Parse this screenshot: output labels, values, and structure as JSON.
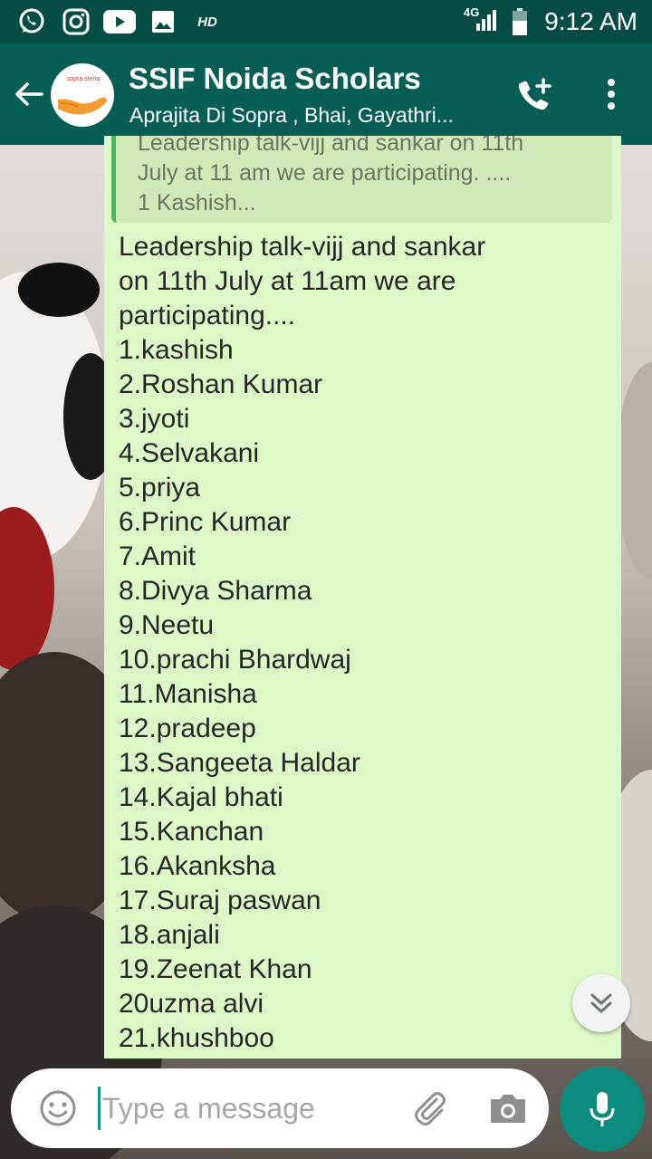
{
  "status_bar": {
    "time": "9:12 AM",
    "hd_label": "HD",
    "network_label": "4G",
    "icons": [
      "whatsapp-icon",
      "instagram-icon",
      "youtube-icon",
      "gallery-icon",
      "signal-icon",
      "battery-icon"
    ]
  },
  "toolbar": {
    "title": "SSIF Noida Scholars",
    "subtitle": "Aprajita Di Sopra , Bhai, Gayathri...",
    "avatar_logo_text": "sopra steria",
    "icons": [
      "back-arrow-icon",
      "add-call-icon",
      "more-vert-icon"
    ]
  },
  "quote": {
    "text_lines": [
      "Leadership talk-vijj and sankar on 11th",
      "July at 11 am we are participating. ....",
      "1 Kashish..."
    ]
  },
  "message": {
    "lines": [
      "Leadership talk-vijj and sankar",
      "on 11th July at 11am we are",
      "participating....",
      "1.kashish",
      "2.Roshan Kumar",
      "3.jyoti",
      "4.Selvakani",
      "5.priya",
      "6.Princ Kumar",
      "7.Amit",
      "8.Divya Sharma",
      "9.Neetu",
      "10.prachi Bhardwaj",
      "11.Manisha",
      "12.pradeep",
      "13.Sangeeta Haldar",
      "14.Kajal bhati",
      "15.Kanchan",
      "16.Akanksha",
      "17.Suraj paswan",
      "18.anjali",
      "19.Zeenat Khan",
      "20uzma alvi",
      "21.khushboo"
    ]
  },
  "input": {
    "placeholder": "Type a message",
    "value": ""
  },
  "colors": {
    "status_bar": "#054d44",
    "toolbar": "#075e54",
    "bubble": "#dcf8c6",
    "quote_bg": "#cfeab8",
    "quote_bar": "#3fbf55",
    "mic_button": "#0c8c7e"
  }
}
